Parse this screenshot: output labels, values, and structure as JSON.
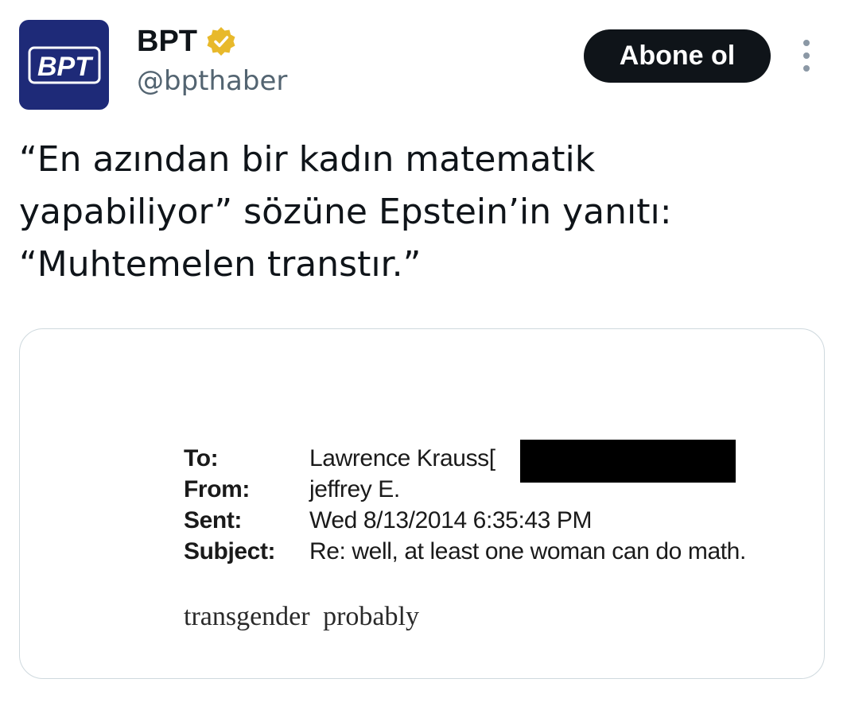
{
  "account": {
    "display_name": "BPT",
    "handle": "@bpthaber",
    "avatar_text": "BPT",
    "verified_color": "#e8b92b",
    "avatar_bg": "#1e2a78"
  },
  "actions": {
    "follow_label": "Abone ol",
    "more_icon": "more-vertical-icon"
  },
  "tweet": {
    "lines": [
      "“En azından bir kadın matematik",
      "yapabiliyor” sözüne Epstein’in yanıtı:",
      "“Muhtemelen transtır.”"
    ]
  },
  "email": {
    "rows": [
      {
        "key": "To:",
        "value": "Lawrence Krauss["
      },
      {
        "key": "From:",
        "value": "jeffrey E."
      },
      {
        "key": "Sent:",
        "value": "Wed 8/13/2014 6:35:43 PM"
      },
      {
        "key": "Subject:",
        "value": "Re: well, at least one woman can do math."
      }
    ],
    "body": "transgender probably"
  }
}
